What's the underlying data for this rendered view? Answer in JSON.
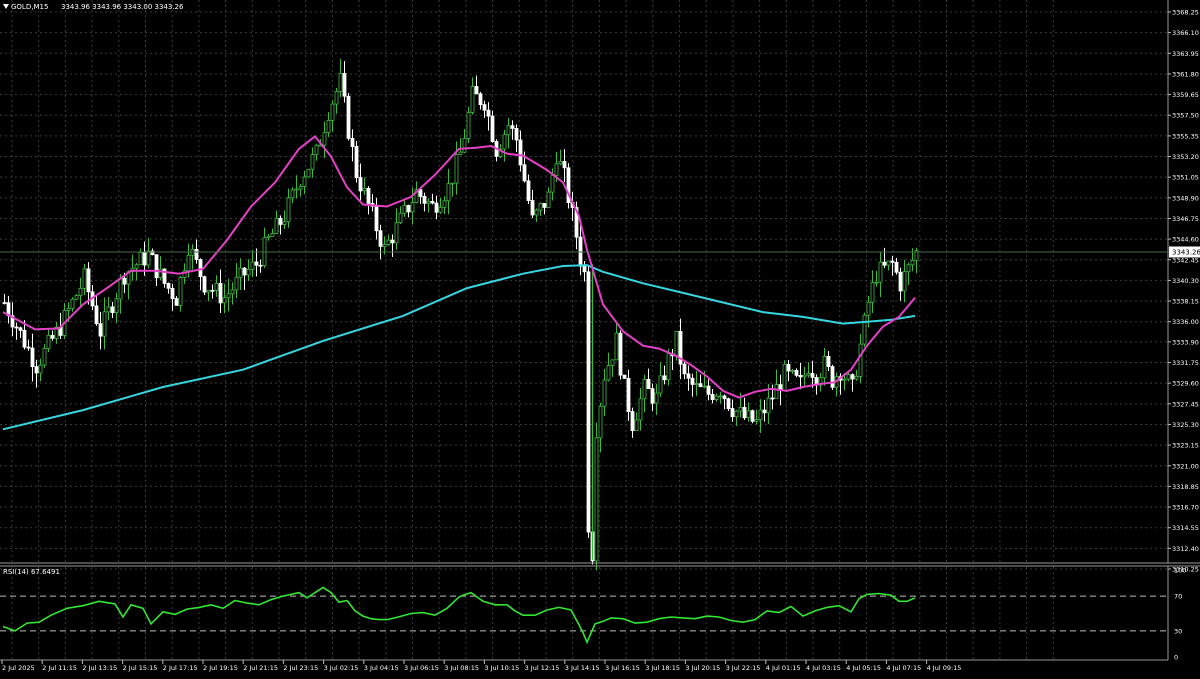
{
  "chart_header": {
    "symbol_tf": "GOLD,M15",
    "ohlc": "3343.96 3343.96 3343.00 3343.26"
  },
  "rsi_header": {
    "label": "RSI(14) 67.6491"
  },
  "price_axis": {
    "current_price_label": "3343.26"
  },
  "colors": {
    "background": "#000000",
    "grid": "#3a3a3a",
    "bull": "#3fb83f",
    "bear": "#ffffff",
    "ma_fast": "#e640c8",
    "ma_slow": "#36d6e0",
    "rsi": "#32e632"
  },
  "chart_data": [
    {
      "type": "candlestick",
      "title": "GOLD,M15",
      "ylim": [
        3310.25,
        3368.25
      ],
      "y_ticks": [
        "3368.25",
        "3366.10",
        "3363.95",
        "3361.80",
        "3359.65",
        "3357.50",
        "3355.35",
        "3353.20",
        "3351.05",
        "3348.90",
        "3346.75",
        "3344.60",
        "3342.45",
        "3340.30",
        "3338.15",
        "3336.00",
        "3333.90",
        "3331.75",
        "3329.60",
        "3327.45",
        "3325.30",
        "3323.15",
        "3321.00",
        "3318.85",
        "3316.70",
        "3314.55",
        "3312.40",
        "3310.25"
      ],
      "x_ticks": [
        "2 Jul 2025",
        "2 Jul 11:15",
        "2 Jul 13:15",
        "2 Jul 15:15",
        "2 Jul 17:15",
        "2 Jul 19:15",
        "2 Jul 21:15",
        "2 Jul 23:15",
        "3 Jul 02:15",
        "3 Jul 04:15",
        "3 Jul 06:15",
        "3 Jul 08:15",
        "3 Jul 10:15",
        "3 Jul 12:15",
        "3 Jul 14:15",
        "3 Jul 16:15",
        "3 Jul 18:15",
        "3 Jul 20:15",
        "3 Jul 22:15",
        "4 Jul 01:15",
        "4 Jul 03:15",
        "4 Jul 05:15",
        "4 Jul 07:15",
        "4 Jul 09:15"
      ],
      "close_path": [
        [
          0,
          3338.0
        ],
        [
          8,
          3331.5
        ],
        [
          14,
          3335.5
        ],
        [
          20,
          3340.5
        ],
        [
          24,
          3335.0
        ],
        [
          30,
          3341.0
        ],
        [
          36,
          3343.0
        ],
        [
          40,
          3340.0
        ],
        [
          43,
          3338.5
        ],
        [
          46,
          3344.0
        ],
        [
          50,
          3340.0
        ],
        [
          55,
          3338.5
        ],
        [
          60,
          3341.0
        ],
        [
          63,
          3342.0
        ],
        [
          66,
          3344.5
        ],
        [
          70,
          3347.0
        ],
        [
          74,
          3351.0
        ],
        [
          78,
          3353.5
        ],
        [
          81,
          3358.0
        ],
        [
          84,
          3361.0
        ],
        [
          86,
          3356.0
        ],
        [
          88,
          3351.5
        ],
        [
          92,
          3347.0
        ],
        [
          95,
          3343.5
        ],
        [
          99,
          3346.5
        ],
        [
          103,
          3349.5
        ],
        [
          107,
          3348.0
        ],
        [
          111,
          3350.0
        ],
        [
          114,
          3353.5
        ],
        [
          117,
          3359.5
        ],
        [
          120,
          3359.0
        ],
        [
          123,
          3354.0
        ],
        [
          126,
          3356.5
        ],
        [
          128,
          3355.0
        ],
        [
          132,
          3346.5
        ],
        [
          136,
          3349.0
        ],
        [
          138,
          3353.5
        ],
        [
          140,
          3351.0
        ],
        [
          143,
          3345.0
        ],
        [
          144,
          3342.5
        ],
        [
          145,
          3341.0
        ],
        [
          146,
          3315.0
        ],
        [
          147,
          3312.0
        ],
        [
          148,
          3325.0
        ],
        [
          150,
          3330.5
        ],
        [
          153,
          3334.0
        ],
        [
          155,
          3329.0
        ],
        [
          157,
          3325.5
        ],
        [
          160,
          3329.0
        ],
        [
          163,
          3328.0
        ],
        [
          166,
          3332.0
        ],
        [
          168,
          3334.0
        ],
        [
          170,
          3330.0
        ],
        [
          173,
          3329.0
        ],
        [
          176,
          3328.5
        ],
        [
          179,
          3329.0
        ],
        [
          182,
          3327.0
        ],
        [
          185,
          3326.0
        ],
        [
          188,
          3325.5
        ],
        [
          191,
          3327.5
        ],
        [
          193,
          3329.0
        ],
        [
          195,
          3330.5
        ],
        [
          197,
          3330.0
        ],
        [
          199,
          3329.5
        ],
        [
          201,
          3331.5
        ],
        [
          203,
          3330.5
        ],
        [
          205,
          3331.5
        ],
        [
          207,
          3330.0
        ],
        [
          209,
          3331.0
        ],
        [
          212,
          3329.0
        ],
        [
          214,
          3333.5
        ],
        [
          216,
          3338.0
        ],
        [
          218,
          3341.0
        ],
        [
          220,
          3341.5
        ],
        [
          222,
          3342.0
        ],
        [
          224,
          3340.0
        ],
        [
          226,
          3341.5
        ],
        [
          228,
          3343.26
        ]
      ],
      "ma_fast_path": [
        [
          0,
          3337.0
        ],
        [
          8,
          3335.2
        ],
        [
          14,
          3335.3
        ],
        [
          20,
          3337.8
        ],
        [
          26,
          3339.5
        ],
        [
          32,
          3341.3
        ],
        [
          38,
          3341.3
        ],
        [
          44,
          3341.0
        ],
        [
          50,
          3341.5
        ],
        [
          56,
          3344.5
        ],
        [
          62,
          3348.0
        ],
        [
          68,
          3350.5
        ],
        [
          74,
          3354.0
        ],
        [
          78,
          3355.3
        ],
        [
          82,
          3353.2
        ],
        [
          86,
          3350.0
        ],
        [
          90,
          3348.2
        ],
        [
          96,
          3348.0
        ],
        [
          102,
          3349.0
        ],
        [
          108,
          3351.3
        ],
        [
          114,
          3354.0
        ],
        [
          118,
          3354.1
        ],
        [
          122,
          3354.3
        ],
        [
          126,
          3353.5
        ],
        [
          130,
          3353.3
        ],
        [
          136,
          3351.8
        ],
        [
          140,
          3350.5
        ],
        [
          144,
          3347.0
        ],
        [
          146,
          3343.5
        ],
        [
          150,
          3337.8
        ],
        [
          155,
          3335.0
        ],
        [
          160,
          3333.5
        ],
        [
          164,
          3333.2
        ],
        [
          168,
          3332.5
        ],
        [
          172,
          3331.5
        ],
        [
          176,
          3330.3
        ],
        [
          180,
          3328.8
        ],
        [
          184,
          3328.1
        ],
        [
          188,
          3328.7
        ],
        [
          192,
          3329.0
        ],
        [
          196,
          3328.8
        ],
        [
          200,
          3329.2
        ],
        [
          204,
          3329.5
        ],
        [
          208,
          3329.7
        ],
        [
          212,
          3331.0
        ],
        [
          216,
          3333.5
        ],
        [
          220,
          3335.5
        ],
        [
          224,
          3336.5
        ],
        [
          228,
          3338.5
        ]
      ],
      "ma_slow_path": [
        [
          0,
          3324.8
        ],
        [
          20,
          3326.8
        ],
        [
          40,
          3329.2
        ],
        [
          60,
          3331.0
        ],
        [
          80,
          3334.0
        ],
        [
          100,
          3336.6
        ],
        [
          116,
          3339.5
        ],
        [
          130,
          3341.0
        ],
        [
          140,
          3341.8
        ],
        [
          146,
          3341.9
        ],
        [
          150,
          3341.2
        ],
        [
          160,
          3340.0
        ],
        [
          170,
          3339.0
        ],
        [
          180,
          3338.0
        ],
        [
          190,
          3337.0
        ],
        [
          200,
          3336.5
        ],
        [
          210,
          3335.8
        ],
        [
          216,
          3336.0
        ],
        [
          222,
          3336.2
        ],
        [
          228,
          3336.6
        ]
      ]
    },
    {
      "type": "line",
      "title": "RSI(14) 67.6491",
      "ylim": [
        0,
        100
      ],
      "y_ticks": [
        "100",
        "70",
        "30",
        "0"
      ],
      "levels": [
        70,
        30
      ],
      "series": [
        {
          "values": [
            [
              0,
              35
            ],
            [
              3,
              30
            ],
            [
              6,
              39
            ],
            [
              9,
              40
            ],
            [
              12,
              48
            ],
            [
              16,
              56
            ],
            [
              20,
              59
            ],
            [
              24,
              64
            ],
            [
              28,
              61
            ],
            [
              30,
              46
            ],
            [
              32,
              60
            ],
            [
              35,
              56
            ],
            [
              37,
              38
            ],
            [
              40,
              52
            ],
            [
              43,
              49
            ],
            [
              46,
              55
            ],
            [
              49,
              57
            ],
            [
              52,
              60
            ],
            [
              55,
              56
            ],
            [
              58,
              65
            ],
            [
              61,
              62
            ],
            [
              64,
              60
            ],
            [
              67,
              66
            ],
            [
              70,
              70
            ],
            [
              74,
              74
            ],
            [
              76,
              68
            ],
            [
              80,
              80
            ],
            [
              82,
              74
            ],
            [
              84,
              63
            ],
            [
              86,
              65
            ],
            [
              88,
              53
            ],
            [
              90,
              47
            ],
            [
              92,
              44
            ],
            [
              94,
              43
            ],
            [
              96,
              43
            ],
            [
              98,
              45
            ],
            [
              102,
              50
            ],
            [
              105,
              51
            ],
            [
              108,
              48
            ],
            [
              111,
              56
            ],
            [
              114,
              69
            ],
            [
              115,
              71
            ],
            [
              117,
              74
            ],
            [
              120,
              64
            ],
            [
              123,
              60
            ],
            [
              126,
              60
            ],
            [
              128,
              53
            ],
            [
              130,
              48
            ],
            [
              133,
              48
            ],
            [
              136,
              54
            ],
            [
              139,
              57
            ],
            [
              142,
              54
            ],
            [
              144,
              37
            ],
            [
              145,
              28
            ],
            [
              146,
              17
            ],
            [
              148,
              38
            ],
            [
              150,
              41
            ],
            [
              152,
              45
            ],
            [
              155,
              44
            ],
            [
              158,
              39
            ],
            [
              161,
              40
            ],
            [
              164,
              44
            ],
            [
              167,
              46
            ],
            [
              170,
              45
            ],
            [
              173,
              44
            ],
            [
              176,
              47
            ],
            [
              179,
              46
            ],
            [
              182,
              42
            ],
            [
              185,
              40
            ],
            [
              188,
              43
            ],
            [
              191,
              53
            ],
            [
              194,
              51
            ],
            [
              197,
              58
            ],
            [
              200,
              47
            ],
            [
              203,
              53
            ],
            [
              206,
              57
            ],
            [
              209,
              59
            ],
            [
              212,
              52
            ],
            [
              214,
              67
            ],
            [
              216,
              72
            ],
            [
              219,
              73
            ],
            [
              222,
              71
            ],
            [
              224,
              64
            ],
            [
              226,
              64
            ],
            [
              228,
              68
            ]
          ]
        }
      ]
    }
  ]
}
